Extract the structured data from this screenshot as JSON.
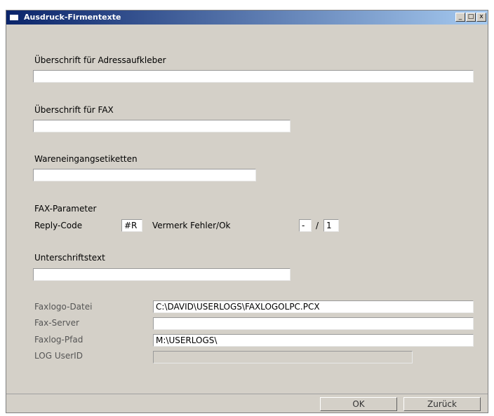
{
  "window": {
    "title": "Ausdruck-Firmentexte",
    "controls": {
      "minimize": "_",
      "maximize": "□",
      "close": "x"
    }
  },
  "form": {
    "adress_header_label": "Überschrift für Adressaufkleber",
    "adress_header_value": "",
    "fax_header_label": "Überschrift für FAX",
    "fax_header_value": "",
    "wareneingang_label": "Wareneingangsetiketten",
    "wareneingang_value": "",
    "fax_params_label": "FAX-Parameter",
    "reply_code_label": "Reply-Code",
    "reply_code_value": "#R",
    "vermerk_label": "Vermerk Fehler/Ok",
    "vermerk_fehler_value": "-",
    "vermerk_separator": "/",
    "vermerk_ok_value": "1",
    "signature_label": "Unterschriftstext",
    "signature_value": "",
    "faxlogo_file_label": "Faxlogo-Datei",
    "faxlogo_file_value": "C:\\DAVID\\USERLOGS\\FAXLOGOLPC.PCX",
    "fax_server_label": "Fax-Server",
    "fax_server_value": "",
    "faxlog_path_label": "Faxlog-Pfad",
    "faxlog_path_value": "M:\\USERLOGS\\",
    "log_userid_label": "LOG UserID",
    "log_userid_value": ""
  },
  "buttons": {
    "ok": "OK",
    "back": "Zurück"
  }
}
